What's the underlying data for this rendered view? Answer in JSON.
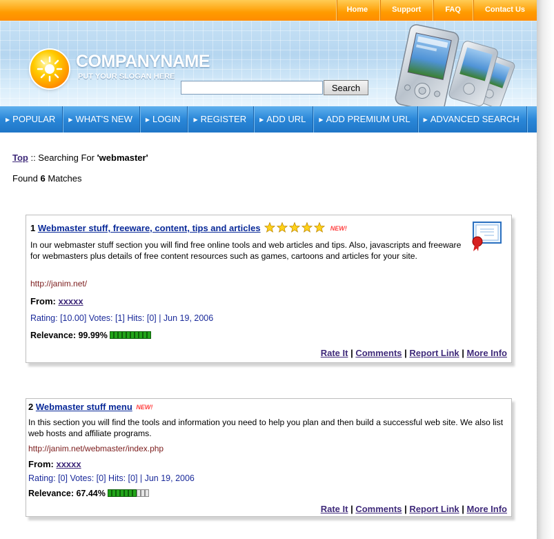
{
  "top_nav": [
    "Home",
    "Support",
    "FAQ",
    "Contact Us"
  ],
  "header": {
    "company_name": "COMPANYNAME",
    "slogan": "PUT YOUR SLOGAN HERE",
    "search_value": "",
    "search_button": "Search"
  },
  "main_nav": [
    "POPULAR",
    "WHAT'S NEW",
    "LOGIN",
    "REGISTER",
    "ADD URL",
    "ADD PREMIUM URL",
    "ADVANCED SEARCH"
  ],
  "breadcrumb": {
    "top_link": "Top",
    "separator": " :: Searching For ",
    "query": "'webmaster'"
  },
  "found": {
    "prefix": "Found ",
    "count": "6",
    "suffix": " Matches"
  },
  "results": [
    {
      "number": "1",
      "title": "Webmaster stuff, freeware, content, tips and articles",
      "stars": 5,
      "new_label": "NEW!",
      "description": "In our webmaster stuff section you will find free online tools and web articles and tips. Also, javascripts and freeware for webmasters plus details of free content resources such as games, cartoons and articles for your site.",
      "url": "http://janim.net/",
      "from_label": "From:",
      "from_user": "xxxxx",
      "meta": "Rating: [10.00] Votes: [1] Hits: [0] | Jun 19, 2006",
      "relevance_label": "Relevance: 99.99%",
      "relevance_fraction": 0.9999,
      "actions": [
        "Rate It",
        "Comments",
        "Report Link",
        "More Info"
      ]
    },
    {
      "number": "2",
      "title": "Webmaster stuff menu",
      "stars": 0,
      "new_label": "NEW!",
      "description": "In this section you will find the tools and information you need to help you plan and then build a successful web site. We also list web hosts and affiliate programs.",
      "url": "http://janim.net/webmaster/index.php",
      "from_label": "From:",
      "from_user": "xxxxx",
      "meta": "Rating: [0] Votes: [0] Hits: [0] | Jun 19, 2006",
      "relevance_label": "Relevance: 67.44%",
      "relevance_fraction": 0.6744,
      "actions": [
        "Rate It",
        "Comments",
        "Report Link",
        "More Info"
      ]
    }
  ]
}
